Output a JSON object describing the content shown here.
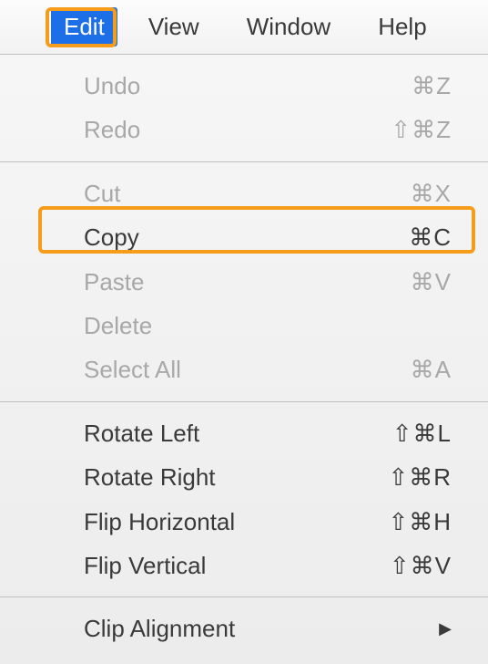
{
  "menubar": {
    "edit": "Edit",
    "view": "View",
    "window": "Window",
    "help": "Help"
  },
  "menu": {
    "undo": {
      "label": "Undo",
      "shortcut": "⌘Z"
    },
    "redo": {
      "label": "Redo",
      "shortcut": "⇧⌘Z"
    },
    "cut": {
      "label": "Cut",
      "shortcut": "⌘X"
    },
    "copy": {
      "label": "Copy",
      "shortcut": "⌘C"
    },
    "paste": {
      "label": "Paste",
      "shortcut": "⌘V"
    },
    "delete": {
      "label": "Delete",
      "shortcut": ""
    },
    "selectAll": {
      "label": "Select All",
      "shortcut": "⌘A"
    },
    "rotateLeft": {
      "label": "Rotate Left",
      "shortcut": "⇧⌘L"
    },
    "rotateRight": {
      "label": "Rotate Right",
      "shortcut": "⇧⌘R"
    },
    "flipHorizontal": {
      "label": "Flip Horizontal",
      "shortcut": "⇧⌘H"
    },
    "flipVertical": {
      "label": "Flip Vertical",
      "shortcut": "⇧⌘V"
    },
    "clipAlignment": {
      "label": "Clip Alignment",
      "arrow": "▶"
    }
  }
}
